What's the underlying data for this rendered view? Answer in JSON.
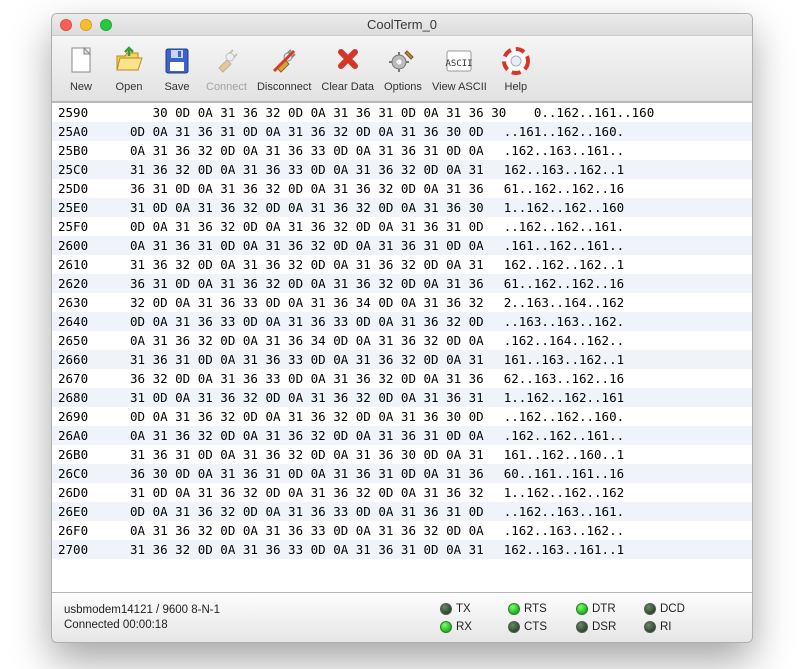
{
  "window_title": "CoolTerm_0",
  "toolbar": [
    {
      "key": "new",
      "label": "New",
      "disabled": false
    },
    {
      "key": "open",
      "label": "Open",
      "disabled": false
    },
    {
      "key": "save",
      "label": "Save",
      "disabled": false
    },
    {
      "key": "connect",
      "label": "Connect",
      "disabled": true
    },
    {
      "key": "disconnect",
      "label": "Disconnect",
      "disabled": false
    },
    {
      "key": "clear",
      "label": "Clear Data",
      "disabled": false
    },
    {
      "key": "options",
      "label": "Options",
      "disabled": false
    },
    {
      "key": "viewascii",
      "label": "View ASCII",
      "disabled": false
    },
    {
      "key": "help",
      "label": "Help",
      "disabled": false
    }
  ],
  "hex_rows": [
    {
      "addr": "2590",
      "hex": "   30 0D 0A 31 36 32 0D 0A 31 36 31 0D 0A 31 36 30",
      "ascii": " 0..162..161..160"
    },
    {
      "addr": "25A0",
      "hex": "0D 0A 31 36 31 0D 0A 31 36 32 0D 0A 31 36 30 0D",
      "ascii": "..161..162..160."
    },
    {
      "addr": "25B0",
      "hex": "0A 31 36 32 0D 0A 31 36 33 0D 0A 31 36 31 0D 0A",
      "ascii": ".162..163..161.."
    },
    {
      "addr": "25C0",
      "hex": "31 36 32 0D 0A 31 36 33 0D 0A 31 36 32 0D 0A 31",
      "ascii": "162..163..162..1"
    },
    {
      "addr": "25D0",
      "hex": "36 31 0D 0A 31 36 32 0D 0A 31 36 32 0D 0A 31 36",
      "ascii": "61..162..162..16"
    },
    {
      "addr": "25E0",
      "hex": "31 0D 0A 31 36 32 0D 0A 31 36 32 0D 0A 31 36 30",
      "ascii": "1..162..162..160"
    },
    {
      "addr": "25F0",
      "hex": "0D 0A 31 36 32 0D 0A 31 36 32 0D 0A 31 36 31 0D",
      "ascii": "..162..162..161."
    },
    {
      "addr": "2600",
      "hex": "0A 31 36 31 0D 0A 31 36 32 0D 0A 31 36 31 0D 0A",
      "ascii": ".161..162..161.."
    },
    {
      "addr": "2610",
      "hex": "31 36 32 0D 0A 31 36 32 0D 0A 31 36 32 0D 0A 31",
      "ascii": "162..162..162..1"
    },
    {
      "addr": "2620",
      "hex": "36 31 0D 0A 31 36 32 0D 0A 31 36 32 0D 0A 31 36",
      "ascii": "61..162..162..16"
    },
    {
      "addr": "2630",
      "hex": "32 0D 0A 31 36 33 0D 0A 31 36 34 0D 0A 31 36 32",
      "ascii": "2..163..164..162"
    },
    {
      "addr": "2640",
      "hex": "0D 0A 31 36 33 0D 0A 31 36 33 0D 0A 31 36 32 0D",
      "ascii": "..163..163..162."
    },
    {
      "addr": "2650",
      "hex": "0A 31 36 32 0D 0A 31 36 34 0D 0A 31 36 32 0D 0A",
      "ascii": ".162..164..162.."
    },
    {
      "addr": "2660",
      "hex": "31 36 31 0D 0A 31 36 33 0D 0A 31 36 32 0D 0A 31",
      "ascii": "161..163..162..1"
    },
    {
      "addr": "2670",
      "hex": "36 32 0D 0A 31 36 33 0D 0A 31 36 32 0D 0A 31 36",
      "ascii": "62..163..162..16"
    },
    {
      "addr": "2680",
      "hex": "31 0D 0A 31 36 32 0D 0A 31 36 32 0D 0A 31 36 31",
      "ascii": "1..162..162..161"
    },
    {
      "addr": "2690",
      "hex": "0D 0A 31 36 32 0D 0A 31 36 32 0D 0A 31 36 30 0D",
      "ascii": "..162..162..160."
    },
    {
      "addr": "26A0",
      "hex": "0A 31 36 32 0D 0A 31 36 32 0D 0A 31 36 31 0D 0A",
      "ascii": ".162..162..161.."
    },
    {
      "addr": "26B0",
      "hex": "31 36 31 0D 0A 31 36 32 0D 0A 31 36 30 0D 0A 31",
      "ascii": "161..162..160..1"
    },
    {
      "addr": "26C0",
      "hex": "36 30 0D 0A 31 36 31 0D 0A 31 36 31 0D 0A 31 36",
      "ascii": "60..161..161..16"
    },
    {
      "addr": "26D0",
      "hex": "31 0D 0A 31 36 32 0D 0A 31 36 32 0D 0A 31 36 32",
      "ascii": "1..162..162..162"
    },
    {
      "addr": "26E0",
      "hex": "0D 0A 31 36 32 0D 0A 31 36 33 0D 0A 31 36 31 0D",
      "ascii": "..162..163..161."
    },
    {
      "addr": "26F0",
      "hex": "0A 31 36 32 0D 0A 31 36 33 0D 0A 31 36 32 0D 0A",
      "ascii": ".162..163..162.."
    },
    {
      "addr": "2700",
      "hex": "31 36 32 0D 0A 31 36 33 0D 0A 31 36 31 0D 0A 31",
      "ascii": "162..163..161..1"
    }
  ],
  "status": {
    "port": "usbmodem14121 / 9600 8-N-1",
    "connected": "Connected 00:00:18",
    "leds": [
      {
        "name": "TX",
        "on": false
      },
      {
        "name": "RTS",
        "on": true
      },
      {
        "name": "DTR",
        "on": true
      },
      {
        "name": "DCD",
        "on": false
      },
      {
        "name": "RX",
        "on": true
      },
      {
        "name": "CTS",
        "on": false
      },
      {
        "name": "DSR",
        "on": false
      },
      {
        "name": "RI",
        "on": false
      }
    ]
  }
}
